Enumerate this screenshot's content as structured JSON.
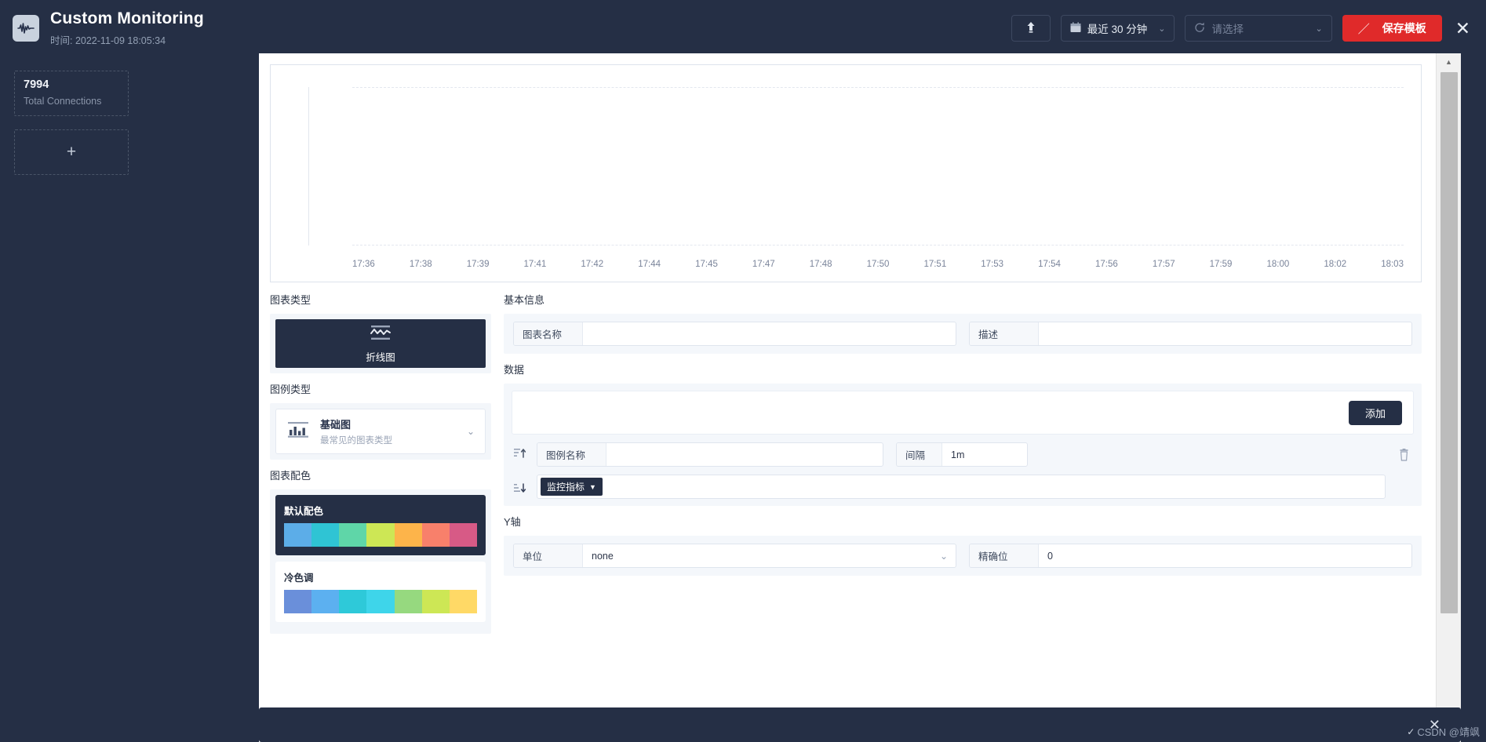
{
  "header": {
    "logo_icon": "waveform-icon",
    "title": "Custom Monitoring",
    "subtitle": "时间: 2022-11-09 18:05:34",
    "upload_icon": "upload-icon",
    "time_range": {
      "icon": "calendar-icon",
      "label": "最近 30 分钟",
      "caret": "⌄"
    },
    "refresh": {
      "icon": "refresh-icon",
      "placeholder": "请选择",
      "caret": "⌄"
    },
    "save_button": {
      "icon": "pencil-slash-icon",
      "label": "保存模板"
    },
    "close_icon": "✕"
  },
  "sidebar": {
    "stat": {
      "value": "7994",
      "label": "Total Connections"
    },
    "add_label": "+"
  },
  "chart_data": {
    "type": "line",
    "title": "",
    "xlabel": "",
    "ylabel": "",
    "series": [],
    "x": [
      "17:36",
      "17:38",
      "17:39",
      "17:41",
      "17:42",
      "17:44",
      "17:45",
      "17:47",
      "17:48",
      "17:50",
      "17:51",
      "17:53",
      "17:54",
      "17:56",
      "17:57",
      "17:59",
      "18:00",
      "18:02",
      "18:03"
    ],
    "grid": true,
    "legend_position": "none",
    "note": "empty plot area - no data series rendered"
  },
  "editor": {
    "chart_type": {
      "section_label": "图表类型",
      "selected": {
        "icon": "line-chart-icon",
        "label": "折线图"
      }
    },
    "legend_type": {
      "section_label": "图例类型",
      "selected": {
        "icon": "bar-chart-icon",
        "title": "基础图",
        "subtitle": "最常见的图表类型",
        "caret": "⌄"
      }
    },
    "palette": {
      "section_label": "图表配色",
      "options": [
        {
          "name": "默认配色",
          "selected": true,
          "colors": [
            "#5cade8",
            "#2fc4d4",
            "#5fd6a8",
            "#cde755",
            "#fdb44a",
            "#f8806b",
            "#d75a86"
          ]
        },
        {
          "name": "冷色调",
          "selected": false,
          "colors": [
            "#6a8fda",
            "#5cb0f0",
            "#2ec9d9",
            "#3ed5ea",
            "#96d97f",
            "#cde755",
            "#ffd966"
          ]
        }
      ]
    },
    "basic_info": {
      "section_label": "基本信息",
      "chart_name": {
        "label": "图表名称",
        "value": "",
        "placeholder": ""
      },
      "description": {
        "label": "描述",
        "value": "",
        "placeholder": ""
      }
    },
    "data": {
      "section_label": "数据",
      "add_button": "添加",
      "series_rows": [
        {
          "drag_up_icon": "sort-up-icon",
          "drag_down_icon": "sort-down-icon",
          "legend_name": {
            "label": "图例名称",
            "value": "",
            "placeholder": ""
          },
          "interval": {
            "label": "间隔",
            "value": "1m"
          },
          "metric_tag": "监控指标",
          "delete_icon": "trash-icon"
        }
      ]
    },
    "y_axis": {
      "section_label": "Y轴",
      "unit": {
        "label": "单位",
        "value": "none",
        "caret": "⌄"
      },
      "precision": {
        "label": "精确位",
        "value": "0"
      }
    }
  },
  "bottom_bar": {
    "close_icon": "✕"
  },
  "watermark": {
    "tick": "✓",
    "text": "CSDN @靖飒"
  },
  "scrollbar": {
    "up_icon": "▲",
    "down_icon": "▼"
  }
}
